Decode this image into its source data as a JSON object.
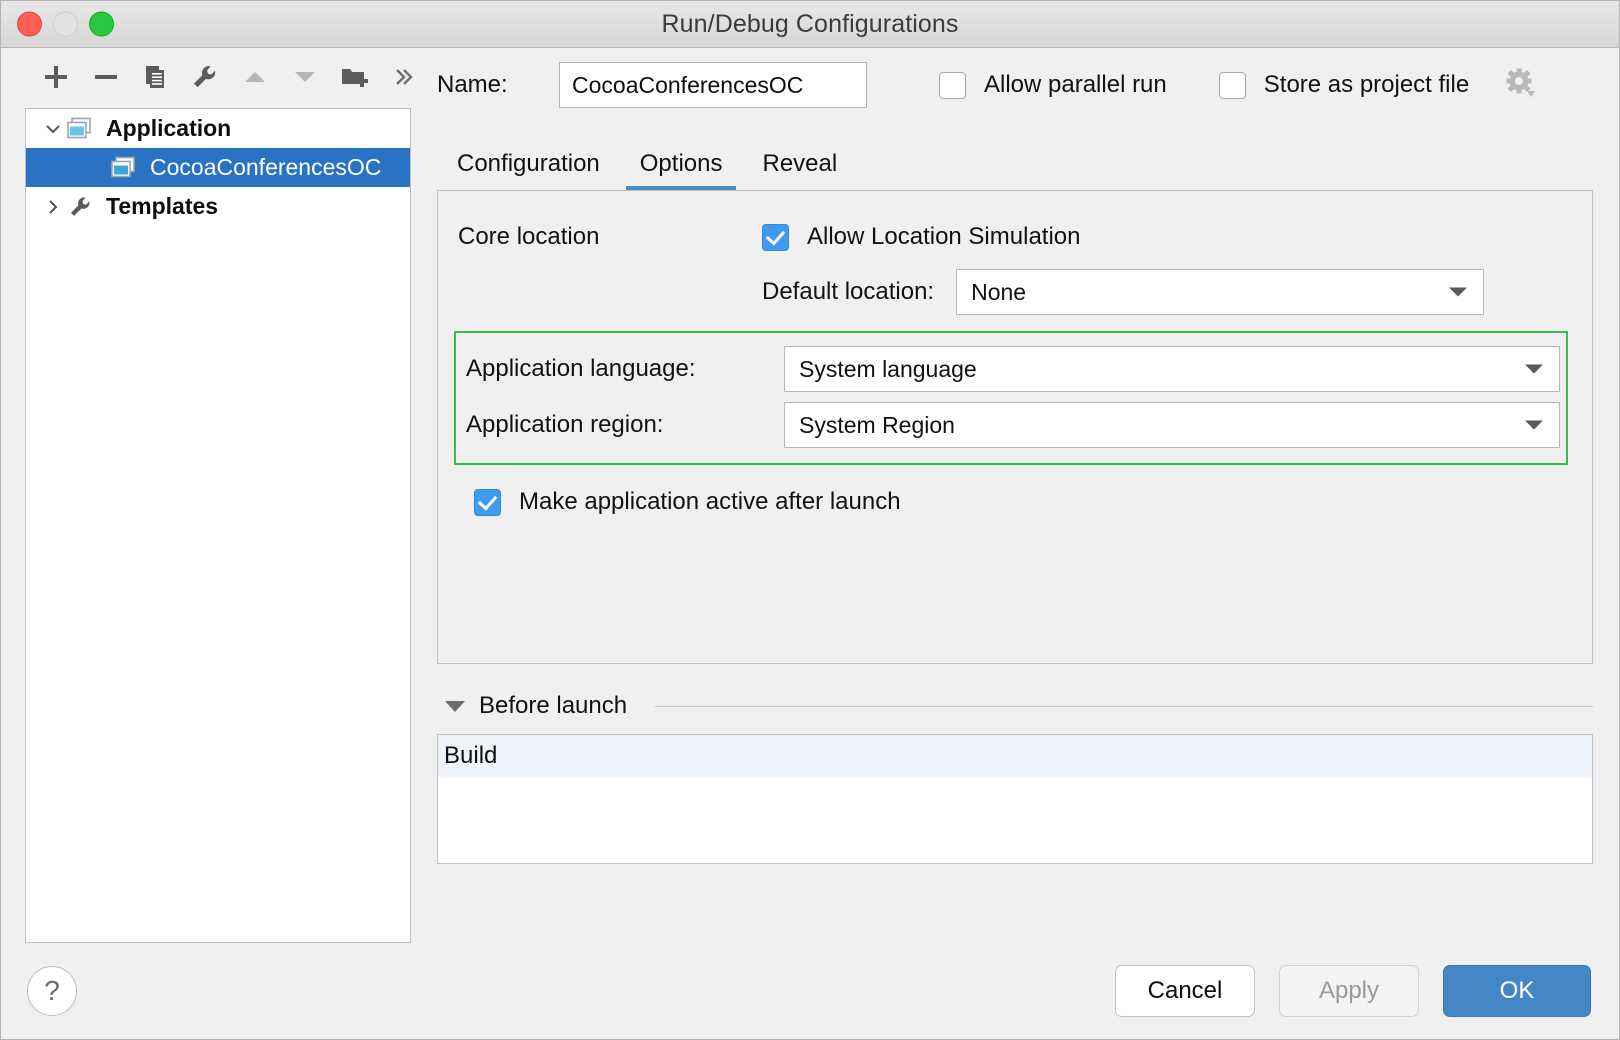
{
  "window": {
    "title": "Run/Debug Configurations",
    "traffic_lights": [
      "close",
      "minimize",
      "zoom"
    ]
  },
  "toolbar": {
    "buttons": [
      {
        "name": "add",
        "icon": "plus-icon"
      },
      {
        "name": "remove",
        "icon": "minus-icon"
      },
      {
        "name": "copy",
        "icon": "copy-icon"
      },
      {
        "name": "edit-templates",
        "icon": "wrench-icon"
      },
      {
        "name": "move-up",
        "icon": "triangle-up-icon"
      },
      {
        "name": "move-down",
        "icon": "triangle-down-icon"
      },
      {
        "name": "move-into-new-folder",
        "icon": "folder-plus-icon"
      },
      {
        "name": "more",
        "icon": "double-chevron-right-icon"
      }
    ]
  },
  "tree": {
    "nodes": [
      {
        "label": "Application",
        "icon": "application-window-icon",
        "twisty": "chevron-down",
        "level": 1,
        "selected": false
      },
      {
        "label": "CocoaConferencesOC",
        "icon": "application-window-icon",
        "twisty": "",
        "level": 2,
        "selected": true
      },
      {
        "label": "Templates",
        "icon": "wrench-icon",
        "twisty": "chevron-right",
        "level": 1,
        "selected": false
      }
    ]
  },
  "name_field": {
    "label": "Name:",
    "value": "CocoaConferencesOC",
    "placeholder": ""
  },
  "top_checkboxes": [
    {
      "label": "Allow parallel run",
      "checked": false
    },
    {
      "label": "Store as project file",
      "checked": false
    }
  ],
  "gear": {
    "icon": "gear-icon"
  },
  "tabs": [
    {
      "label": "Configuration",
      "active": false
    },
    {
      "label": "Options",
      "active": true
    },
    {
      "label": "Reveal",
      "active": false
    }
  ],
  "options_panel": {
    "core_location_label": "Core location",
    "allow_location_simulation": {
      "label": "Allow Location Simulation",
      "checked": true
    },
    "default_location": {
      "label": "Default location:",
      "value": "None"
    },
    "application_language": {
      "label": "Application language:",
      "value": "System language"
    },
    "application_region": {
      "label": "Application region:",
      "value": "System Region"
    },
    "make_active": {
      "label": "Make application active after launch",
      "checked": true
    },
    "highlight_color": "#3cb94a"
  },
  "before_launch": {
    "title": "Before launch",
    "expanded": true,
    "items": [
      "Build"
    ]
  },
  "footer": {
    "help_label": "?",
    "cancel_label": "Cancel",
    "apply_label": "Apply",
    "apply_enabled": false,
    "ok_label": "OK",
    "ok_accent": "#4486c6"
  }
}
